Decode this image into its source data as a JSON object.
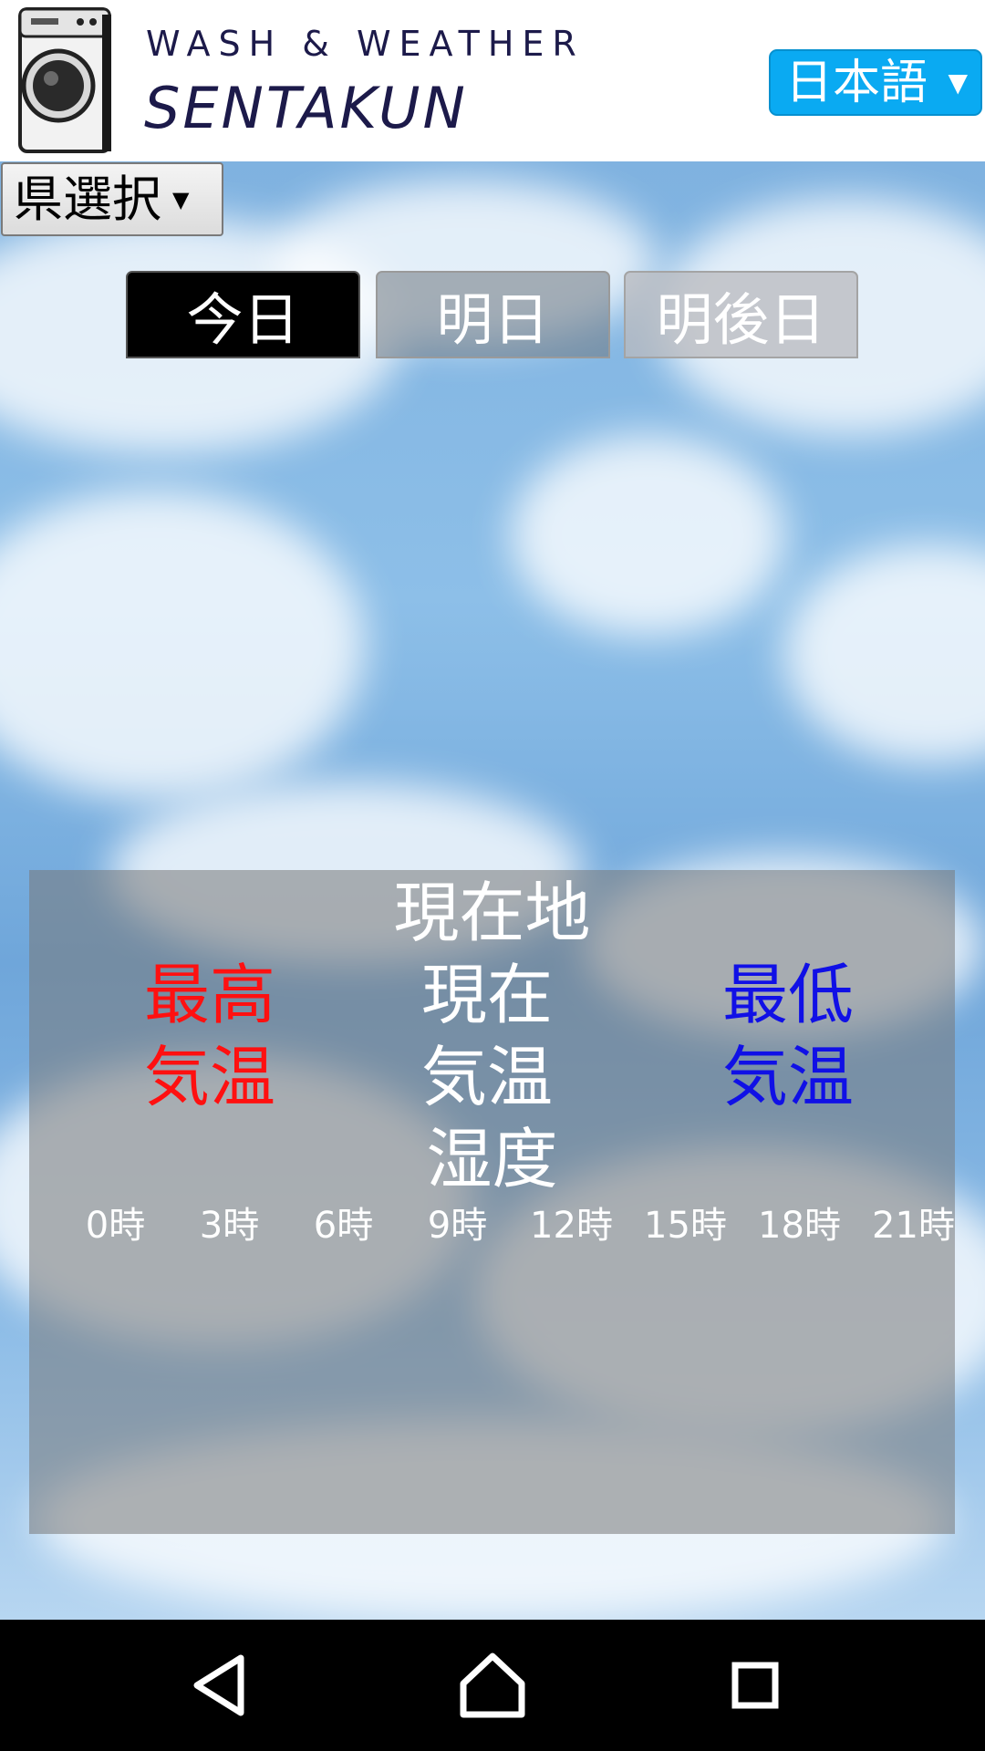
{
  "header": {
    "logo_top": "WASH & WEATHER",
    "logo_main": "SENTAKUN",
    "language_selector": "日本語"
  },
  "prefecture_selector": "県選択",
  "day_tabs": [
    {
      "label": "今日",
      "active": true
    },
    {
      "label": "明日",
      "active": false
    },
    {
      "label": "明後日",
      "active": false
    }
  ],
  "weather_panel": {
    "location": "現在地",
    "max_temp": {
      "line1": "最高",
      "line2": "気温",
      "color": "#ff1010"
    },
    "current_temp": {
      "line1": "現在",
      "line2": "気温",
      "color": "#ffffff"
    },
    "min_temp": {
      "line1": "最低",
      "line2": "気温",
      "color": "#1010e6"
    },
    "humidity": "湿度",
    "hours": [
      "0時",
      "3時",
      "6時",
      "9時",
      "12時",
      "15時",
      "18時",
      "21時"
    ]
  },
  "navigation": {
    "icons": [
      "back-icon",
      "home-icon",
      "recents-icon"
    ]
  },
  "colors": {
    "language_button": "#0aaaf2",
    "active_tab": "#000000"
  }
}
